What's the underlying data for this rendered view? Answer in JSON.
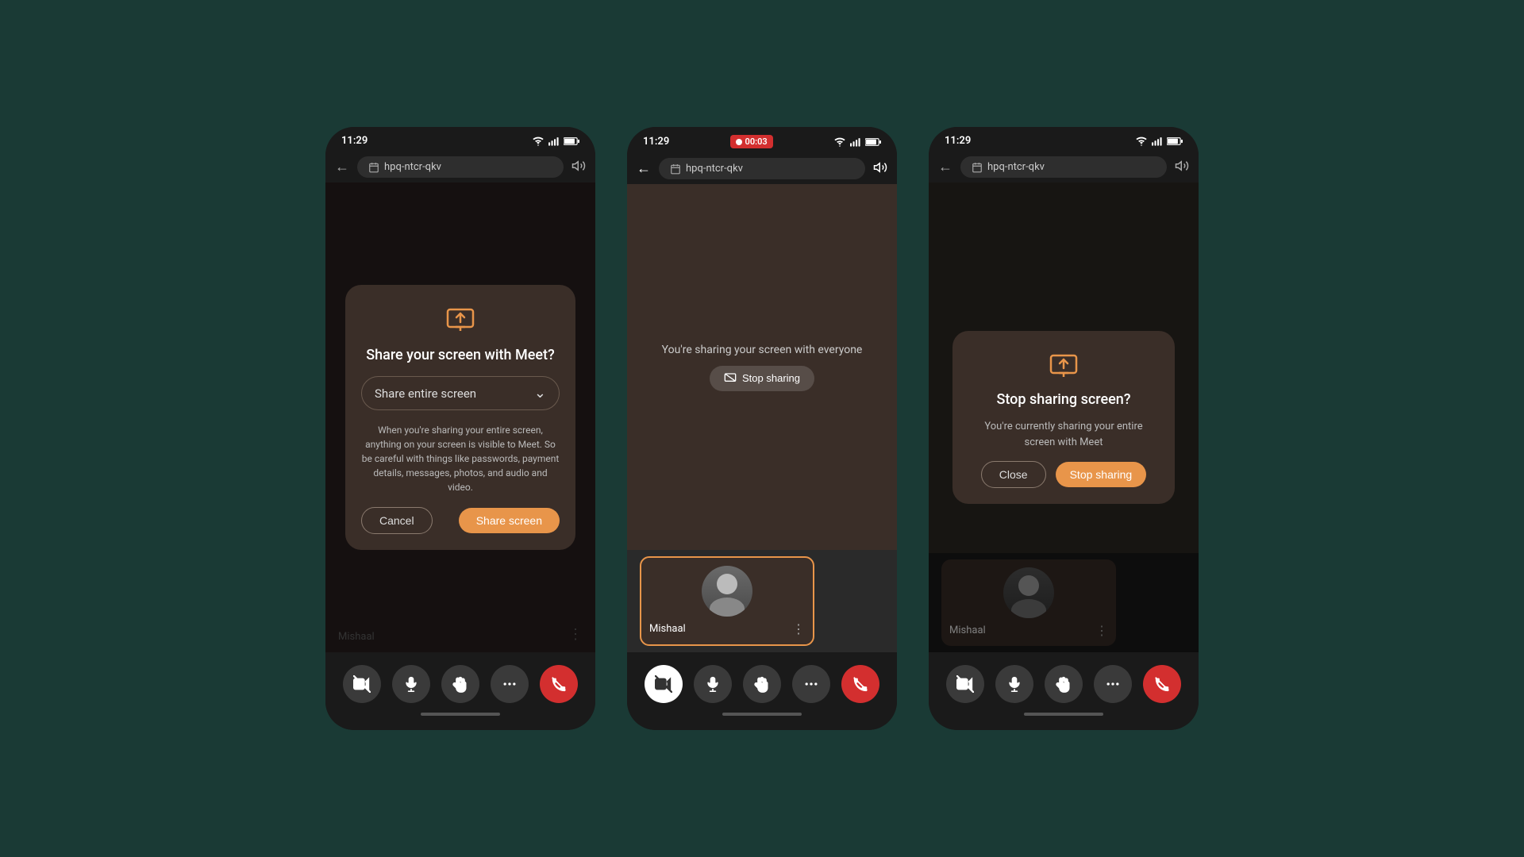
{
  "background_color": "#1a3a35",
  "phones": [
    {
      "id": "phone1",
      "status_bar": {
        "time": "11:29",
        "has_recording": false
      },
      "address_bar": {
        "url": "hpq-ntcr-qkv"
      },
      "dialog": {
        "title": "Share your screen with Meet?",
        "dropdown_label": "Share entire screen",
        "warning_text": "When you're sharing your entire screen, anything on your screen is visible to Meet. So be careful with things like passwords, payment details, messages, photos, and audio and video.",
        "cancel_label": "Cancel",
        "share_label": "Share screen"
      },
      "bottom_user": "Mishaal"
    },
    {
      "id": "phone2",
      "status_bar": {
        "time": "11:29",
        "has_recording": true,
        "recording_time": "00:03"
      },
      "address_bar": {
        "url": "hpq-ntcr-qkv"
      },
      "sharing_text": "You're sharing your screen with everyone",
      "stop_sharing_label": "Stop sharing",
      "user_name": "Mishaal"
    },
    {
      "id": "phone3",
      "status_bar": {
        "time": "11:29",
        "has_recording": false
      },
      "address_bar": {
        "url": "hpq-ntcr-qkv"
      },
      "dialog": {
        "title": "Stop sharing screen?",
        "body_text": "You're currently sharing your entire screen with Meet",
        "close_label": "Close",
        "stop_label": "Stop sharing"
      },
      "user_name": "Mishaal"
    }
  ]
}
